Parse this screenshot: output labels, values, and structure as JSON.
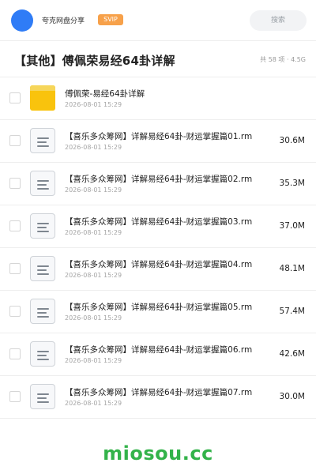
{
  "header": {
    "brand": "夸克网盘分享",
    "badge": "SVIP",
    "search_label": "搜索"
  },
  "share": {
    "title": "【其他】傅佩荣易经64卦详解",
    "meta": "共 58 项 · 4.5G"
  },
  "files": [
    {
      "type": "folder",
      "name": "傅佩荣-易经64卦详解",
      "date": "2026-08-01 15:29",
      "size": ""
    },
    {
      "type": "file",
      "name": "【喜乐多众筹网】详解易经64卦-财运掌握篇01.rm",
      "date": "2026-08-01 15:29",
      "size": "30.6M"
    },
    {
      "type": "file",
      "name": "【喜乐多众筹网】详解易经64卦-财运掌握篇02.rm",
      "date": "2026-08-01 15:29",
      "size": "35.3M"
    },
    {
      "type": "file",
      "name": "【喜乐多众筹网】详解易经64卦-财运掌握篇03.rm",
      "date": "2026-08-01 15:29",
      "size": "37.0M"
    },
    {
      "type": "file",
      "name": "【喜乐多众筹网】详解易经64卦-财运掌握篇04.rm",
      "date": "2026-08-01 15:29",
      "size": "48.1M"
    },
    {
      "type": "file",
      "name": "【喜乐多众筹网】详解易经64卦-财运掌握篇05.rm",
      "date": "2026-08-01 15:29",
      "size": "57.4M"
    },
    {
      "type": "file",
      "name": "【喜乐多众筹网】详解易经64卦-财运掌握篇06.rm",
      "date": "2026-08-01 15:29",
      "size": "42.6M"
    },
    {
      "type": "file",
      "name": "【喜乐多众筹网】详解易经64卦-财运掌握篇07.rm",
      "date": "2026-08-01 15:29",
      "size": "30.0M"
    }
  ],
  "watermark": "miosou.cc",
  "colors": {
    "avatar": "#2f7cf6",
    "badge": "#f7a14a",
    "folder": "#f9c30d",
    "watermark": "#33b34a"
  },
  "icons": {
    "folder": "folder-icon",
    "file": "document-icon"
  }
}
